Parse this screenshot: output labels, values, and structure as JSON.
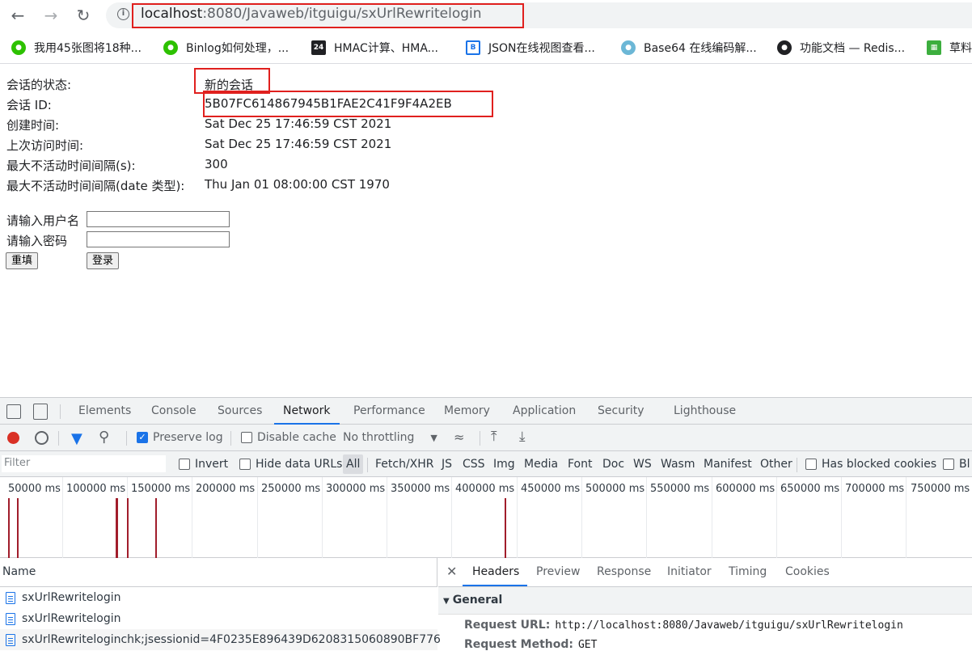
{
  "browser": {
    "url_host": "localhost",
    "url_path": ":8080/Javaweb/itguigu/sxUrlRewritelogin",
    "bookmarks": [
      {
        "label": "我用45张图将18种...",
        "icon": "wechat-icon",
        "color": "#2dc100"
      },
      {
        "label": "Binlog如何处理，...",
        "icon": "wechat-icon",
        "color": "#2dc100"
      },
      {
        "label": "HMAC计算、HMA...",
        "icon": "calendar-icon",
        "color": "#202124"
      },
      {
        "label": "JSON在线视图查看...",
        "icon": "json-icon",
        "color": "#1a73e8"
      },
      {
        "label": "Base64 在线编码解...",
        "icon": "globe-icon",
        "color": "#6cb7d6"
      },
      {
        "label": "功能文档 — Redis...",
        "icon": "github-icon",
        "color": "#202124"
      },
      {
        "label": "草料",
        "icon": "qr-icon",
        "color": "#3cae3e"
      }
    ]
  },
  "session": {
    "state_label": "会话的状态:",
    "state_value": "新的会话",
    "id_label": "会话 ID:",
    "id_value": "5B07FC614867945B1FAE2C41F9F4A2EB",
    "created_label": "创建时间:",
    "created_value": "Sat Dec 25 17:46:59 CST 2021",
    "last_access_label": "上次访问时间:",
    "last_access_value": "Sat Dec 25 17:46:59 CST 2021",
    "max_inactive_label": "最大不活动时间间隔(s):",
    "max_inactive_value": "300",
    "max_inactive_date_label": "最大不活动时间间隔(date 类型):",
    "max_inactive_date_value": "Thu Jan 01 08:00:00 CST 1970"
  },
  "login_form": {
    "username_label": "请输入用户名",
    "password_label": "请输入密码",
    "reset_label": "重填",
    "submit_label": "登录"
  },
  "devtools": {
    "tabs": [
      "Elements",
      "Console",
      "Sources",
      "Network",
      "Performance",
      "Memory",
      "Application",
      "Security",
      "Lighthouse"
    ],
    "active_tab": "Network",
    "toolbar": {
      "preserve_log": "Preserve log",
      "disable_cache": "Disable cache",
      "throttling": "No throttling"
    },
    "filter": {
      "placeholder": "Filter",
      "invert": "Invert",
      "hide_data_urls": "Hide data URLs",
      "types": [
        "All",
        "Fetch/XHR",
        "JS",
        "CSS",
        "Img",
        "Media",
        "Font",
        "Doc",
        "WS",
        "Wasm",
        "Manifest",
        "Other"
      ],
      "has_blocked": "Has blocked cookies",
      "blocked_partial": "Bl"
    },
    "timeline_ticks": [
      "50000 ms",
      "100000 ms",
      "150000 ms",
      "200000 ms",
      "250000 ms",
      "300000 ms",
      "350000 ms",
      "400000 ms",
      "450000 ms",
      "500000 ms",
      "550000 ms",
      "600000 ms",
      "650000 ms",
      "700000 ms",
      "750000 ms"
    ],
    "name_header": "Name",
    "requests": [
      "sxUrlRewritelogin",
      "sxUrlRewritelogin",
      "sxUrlRewriteloginchk;jsessionid=4F0235E896439D6208315060890BF776"
    ],
    "detail_tabs": [
      "Headers",
      "Preview",
      "Response",
      "Initiator",
      "Timing",
      "Cookies"
    ],
    "general_header": "General",
    "request_url_label": "Request URL:",
    "request_url_value": "http://localhost:8080/Javaweb/itguigu/sxUrlRewritelogin",
    "request_method_label": "Request Method:",
    "request_method_value": "GET"
  }
}
